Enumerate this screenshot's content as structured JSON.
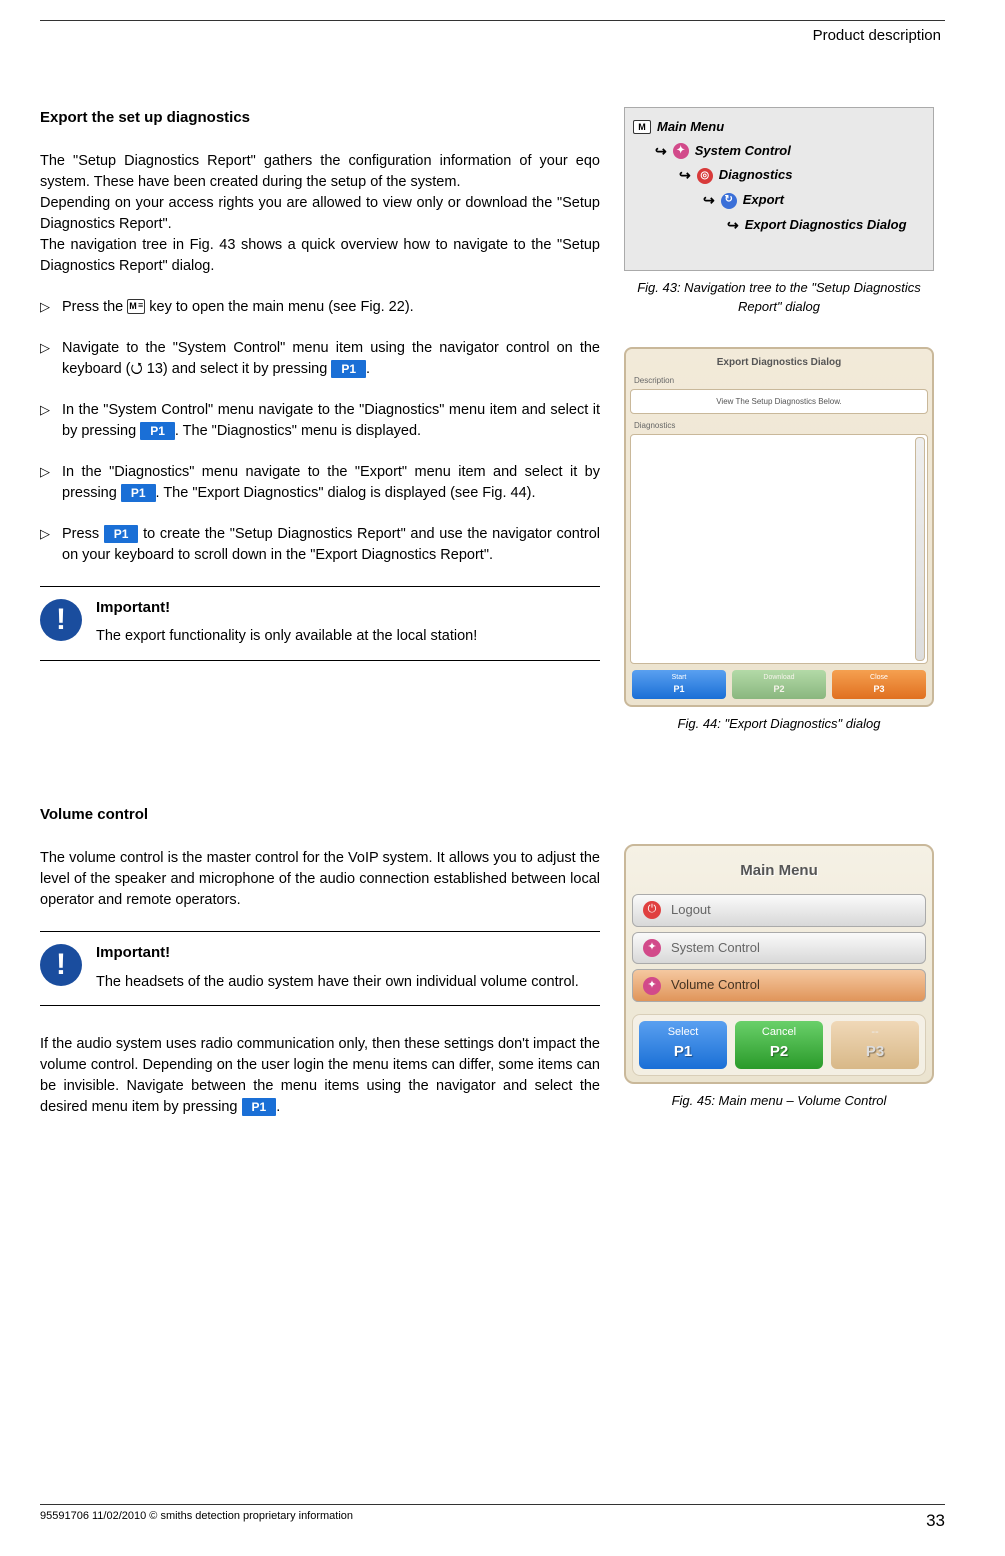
{
  "header": {
    "right": "Product description"
  },
  "section1": {
    "title": "Export the set up diagnostics",
    "intro1": "The \"Setup Diagnostics Report\" gathers the configuration information of your eqo system. These have been created during the setup of the system.",
    "intro2": "Depending on your access rights you are allowed to view only or download the \"Setup Diagnostics Report\".",
    "intro3": "The navigation tree in Fig. 43 shows a quick overview how to navigate to the \"Setup Diagnostics Report\" dialog.",
    "step1a": "Press the ",
    "step1b": " key to open the main menu (see Fig. 22).",
    "step2a": "Navigate to the \"System Control\" menu item using the navigator control on the keyboard (",
    "step2b": " 13) and select it by pressing ",
    "step2c": ".",
    "step3a": "In the \"System Control\" menu navigate to the \"Diagnostics\" menu item and select it by pressing ",
    "step3b": ". The \"Diagnostics\" menu is displayed.",
    "step4a": "In the \"Diagnostics\" menu navigate to the \"Export\" menu item and select it by pressing ",
    "step4b": ". The \"Export Diagnostics\" dialog is displayed (see Fig. 44).",
    "step5a": "Press ",
    "step5b": " to create the \"Setup Diagnostics Report\" and use the navigator control on your keyboard to scroll down in the \"Export Diagnostics Report\".",
    "important_title": "Important!",
    "important_body": "The export functionality is only available at the local station!"
  },
  "section2": {
    "title": "Volume control",
    "intro": "The volume control is the master control for the VoIP system. It allows you to adjust the level of the speaker and microphone of the audio connection established between local operator and remote operators.",
    "important_title": "Important!",
    "important_body": "The headsets of the audio system have their own individual volume control.",
    "para2a": "If the audio system uses radio communication only, then these settings don't impact the volume control. Depending on the user login the menu items can differ, some items can be invisible. Navigate between the menu items using the navigator and select the desired menu item by pressing ",
    "para2b": "."
  },
  "badges": {
    "p1": "P1"
  },
  "fig43": {
    "caption": "Fig. 43: Navigation tree to the \"Setup Diagnostics Report\" dialog",
    "items": {
      "main": "Main Menu",
      "system": "System Control",
      "diag": "Diagnostics",
      "export": "Export",
      "exportdlg": "Export Diagnostics Dialog"
    }
  },
  "fig44": {
    "caption": "Fig. 44: \"Export Diagnostics\" dialog",
    "title": "Export Diagnostics Dialog",
    "desc_label": "Description",
    "desc_text": "View The Setup Diagnostics Below.",
    "diag_label": "Diagnostics",
    "buttons": {
      "start": {
        "label": "Start",
        "key": "P1"
      },
      "download": {
        "label": "Download",
        "key": "P2"
      },
      "close": {
        "label": "Close",
        "key": "P3"
      }
    }
  },
  "fig45": {
    "caption": "Fig. 45: Main menu – Volume Control",
    "title": "Main Menu",
    "items": {
      "logout": "Logout",
      "system": "System Control",
      "volume": "Volume Control"
    },
    "buttons": {
      "select": {
        "label": "Select",
        "key": "P1"
      },
      "cancel": {
        "label": "Cancel",
        "key": "P2"
      },
      "blank": {
        "label": "--",
        "key": "P3"
      }
    }
  },
  "footer": {
    "left": "95591706 11/02/2010 © smiths detection proprietary information",
    "page": "33"
  }
}
